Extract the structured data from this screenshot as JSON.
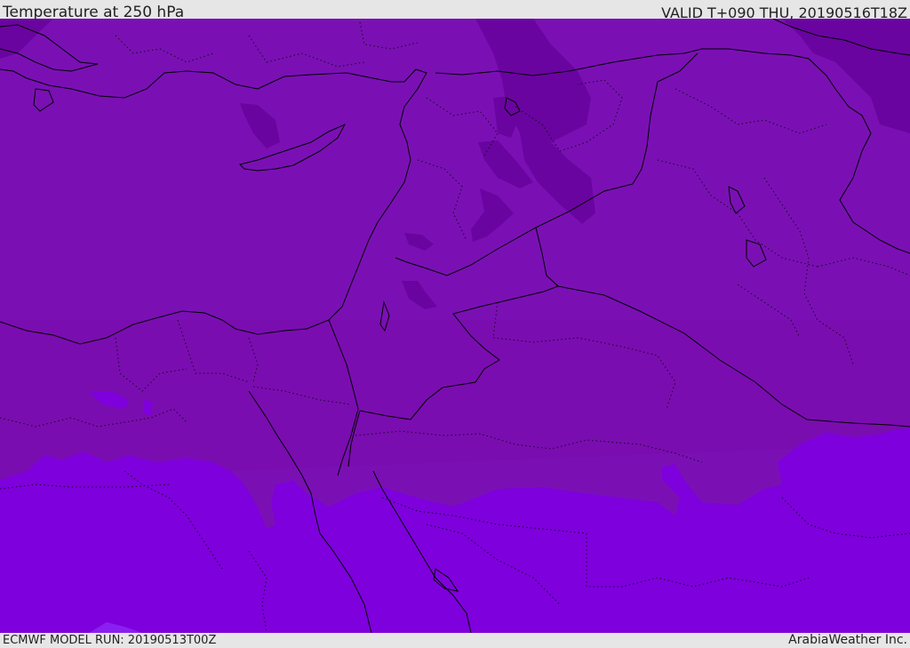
{
  "header": {
    "title": "Temperature at 250 hPa",
    "valid": "VALID T+090 THU, 20190516T18Z"
  },
  "footer": {
    "model_run": "ECMWF MODEL RUN: 20190513T00Z",
    "brand": "ArabiaWeather Inc."
  },
  "colors": {
    "background": "#7a10b4",
    "sea_zone": "#7a10b4",
    "cold_patch": "#6a04a0",
    "warm_band": "#7e00dc",
    "transition": "#7a0ca8",
    "highlight": "#8a20f0",
    "border_line": "#000000"
  }
}
